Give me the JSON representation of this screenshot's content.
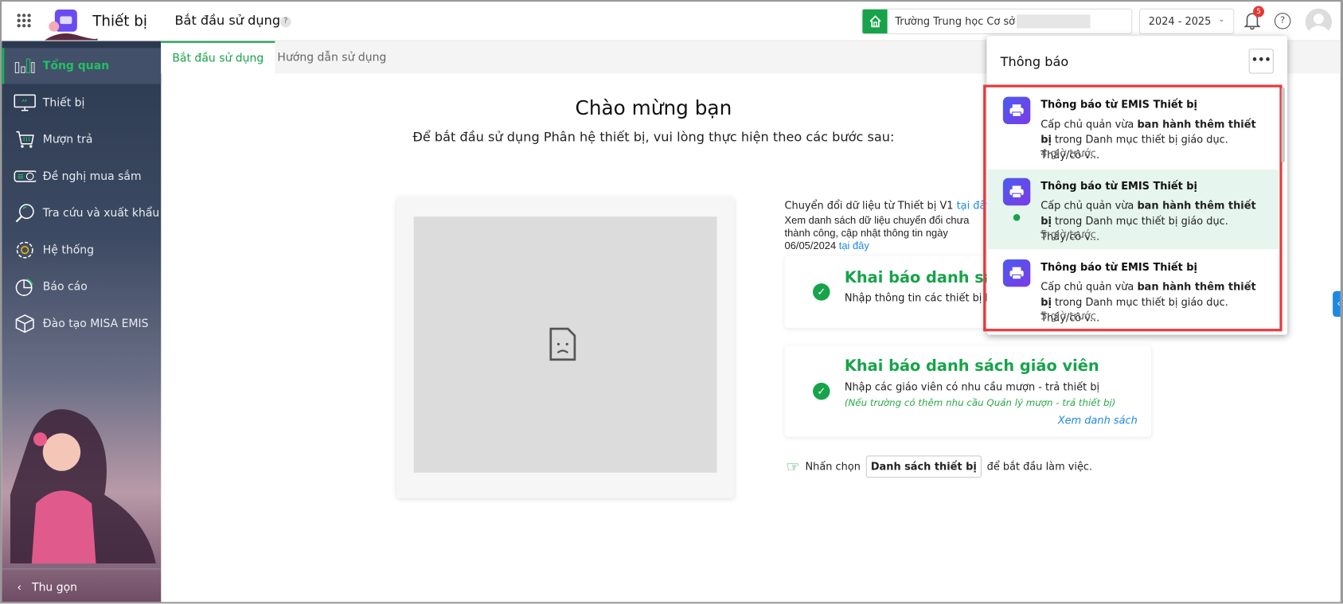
{
  "header": {
    "app_title": "Thiết bị",
    "page_title": "Bắt đầu sử dụng",
    "help": "?",
    "school": "Trường Trung học Cơ sở",
    "year": "2024 - 2025",
    "notification_count": "5"
  },
  "sidebar": {
    "items": [
      {
        "label": "Tổng quan",
        "icon": "chart-bars-icon"
      },
      {
        "label": "Thiết bị",
        "icon": "monitor-icon"
      },
      {
        "label": "Mượn trả",
        "icon": "cart-icon"
      },
      {
        "label": "Đề nghị mua sắm",
        "icon": "projector-icon"
      },
      {
        "label": "Tra cứu và xuất khẩu",
        "icon": "search-icon"
      },
      {
        "label": "Hệ thống",
        "icon": "gear-icon"
      },
      {
        "label": "Báo cáo",
        "icon": "pie-chart-icon"
      },
      {
        "label": "Đào tạo MISA EMIS",
        "icon": "box-icon"
      }
    ],
    "collapse": "Thu gọn"
  },
  "tabs": [
    {
      "label": "Bắt đầu sử dụng"
    },
    {
      "label": "Hướng dẫn sử dụng"
    }
  ],
  "main": {
    "welcome": "Chào mừng bạn",
    "subtitle": "Để bắt đầu sử dụng Phân hệ thiết bị, vui lòng thực hiện theo các bước sau:",
    "convert_text": "Chuyển đổi dữ liệu từ Thiết bị V1",
    "convert_link": "tại đây",
    "list_text": "Xem danh sách dữ liệu chuyển đổi chưa thành công, cập nhật thông tin ngày 06/05/2024",
    "list_link": "tại đây",
    "card1": {
      "title": "Khai báo danh sách thiết bị",
      "desc": "Nhập thông tin các thiết bị hiện có"
    },
    "card2": {
      "title": "Khai báo danh sách giáo viên",
      "desc": "Nhập các giáo viên có nhu cầu mượn - trả thiết bị",
      "note": "(Nếu trường có thêm nhu cầu Quản lý mượn - trả thiết bị)",
      "link": "Xem danh sách"
    },
    "hint_pre": "Nhấn chọn",
    "hint_button": "Danh sách thiết bị",
    "hint_post": "để bắt đầu làm việc."
  },
  "notifications": {
    "title": "Thông báo",
    "more": "•••",
    "items": [
      {
        "title": "Thông báo từ EMIS Thiết bị",
        "pre": "Cấp chủ quản vừa ",
        "bold": "ban hành thêm thiết bị",
        "post": " trong Danh mục thiết bị giáo dục. Thầy/cô v...",
        "time": "4 giờ trước",
        "unread": false
      },
      {
        "title": "Thông báo từ EMIS Thiết bị",
        "pre": "Cấp chủ quản vừa ",
        "bold": "ban hành thêm thiết bị",
        "post": " trong Danh mục thiết bị giáo dục. Thầy/cô v...",
        "time": "5 giờ trước",
        "unread": true
      },
      {
        "title": "Thông báo từ EMIS Thiết bị",
        "pre": "Cấp chủ quản vừa ",
        "bold": "ban hành thêm thiết bị",
        "post": " trong Danh mục thiết bị giáo dục. Thầy/cô v...",
        "time": "5 giờ trước",
        "unread": false
      }
    ]
  },
  "colors": {
    "accent": "#17a34a",
    "link": "#1e88e5",
    "highlight": "#e53940"
  }
}
